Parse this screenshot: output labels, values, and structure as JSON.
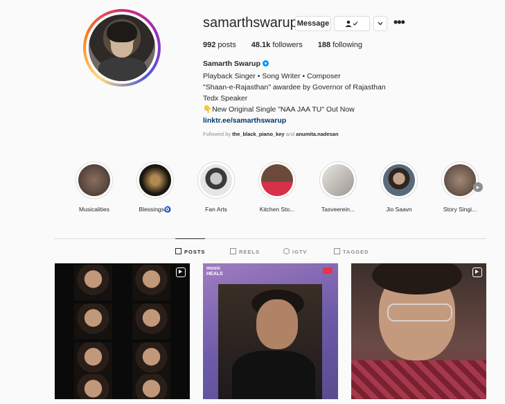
{
  "profile": {
    "username": "samarthswarup",
    "buttons": {
      "message": "Message",
      "follow_icon": "person-check-icon",
      "dropdown_icon": "chevron-down-icon",
      "more": "•••"
    },
    "stats": {
      "posts": "992",
      "posts_label": "posts",
      "followers": "48.1k",
      "followers_label": "followers",
      "following": "188",
      "following_label": "following"
    },
    "full_name": "Samarth Swarup",
    "bio_lines": [
      "Playback Singer • Song Writer • Composer",
      "\"Shaan-e-Rajasthan\" awardee by Governor of Rajasthan",
      "Tedx Speaker",
      "👇New Original Single \"NAA JAA TU\" Out Now"
    ],
    "link": "linktr.ee/samarthswarup",
    "followed_by_prefix": "Followed by",
    "followed_by_1": "the_black_piano_key",
    "followed_by_and": "and",
    "followed_by_2": "anumita.nadesan"
  },
  "highlights": [
    {
      "label": "Musicalities"
    },
    {
      "label": "Blessings🧿"
    },
    {
      "label": "Fan Arts"
    },
    {
      "label": "Kitchen Sto..."
    },
    {
      "label": "Tasveerein..."
    },
    {
      "label": "Jio Saavn"
    },
    {
      "label": "Story Singi..."
    }
  ],
  "tabs": [
    {
      "label": "POSTS",
      "active": true
    },
    {
      "label": "REELS",
      "active": false
    },
    {
      "label": "IGTV",
      "active": false
    },
    {
      "label": "TAGGED",
      "active": false
    }
  ],
  "posts": [
    {
      "type": "reel"
    },
    {
      "type": "reel",
      "overlay": "music\nHEALS"
    },
    {
      "type": "reel"
    }
  ],
  "colors": {
    "link": "#00376b",
    "verified": "#0095f6",
    "border": "#dbdbdb",
    "muted": "#8e8e8e"
  }
}
